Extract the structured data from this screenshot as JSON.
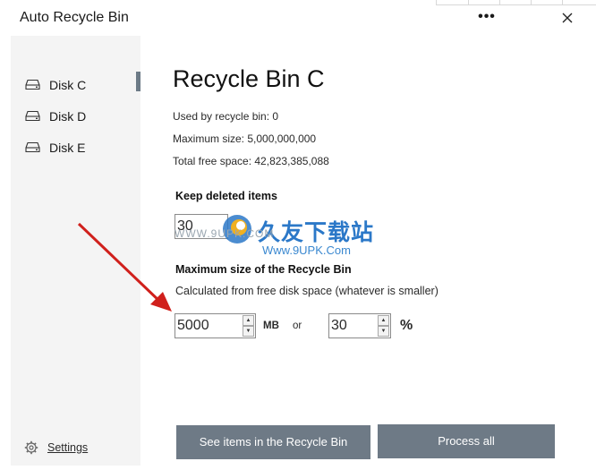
{
  "window": {
    "title": "Auto Recycle Bin",
    "more_label": "•••",
    "close_label": "✕"
  },
  "sidebar": {
    "items": [
      {
        "label": "Disk C",
        "icon": "drive-icon",
        "selected": true
      },
      {
        "label": "Disk D",
        "icon": "drive-icon",
        "selected": false
      },
      {
        "label": "Disk E",
        "icon": "drive-icon",
        "selected": false
      }
    ],
    "settings_label": "Settings",
    "settings_icon": "gear-icon"
  },
  "main": {
    "title": "Recycle Bin C",
    "used": "Used by recycle bin: 0",
    "max_size": "Maximum size: 5,000,000,000",
    "free_space": "Total free space: 42,823,385,088",
    "keep_heading": "Keep deleted items",
    "keep_value": "30",
    "max_heading": "Maximum size of the Recycle Bin",
    "hint": "Calculated from free disk space (whatever is smaller)",
    "mb_value": "5000",
    "mb_unit": "MB",
    "or_label": "or",
    "percent_value": "30",
    "percent_unit": "%",
    "see_items_button": "See items in the Recycle Bin",
    "process_all_button": "Process all"
  },
  "watermark": {
    "cn_text": "久友下载站",
    "url_right": "Www.9UPK.Com",
    "url_left": "WWW.9UPK.COM"
  },
  "colors": {
    "sidebar_bg": "#f4f4f4",
    "accent": "#6e7a86",
    "annotation_arrow": "#d0201c",
    "watermark_blue": "#2b78c8"
  }
}
